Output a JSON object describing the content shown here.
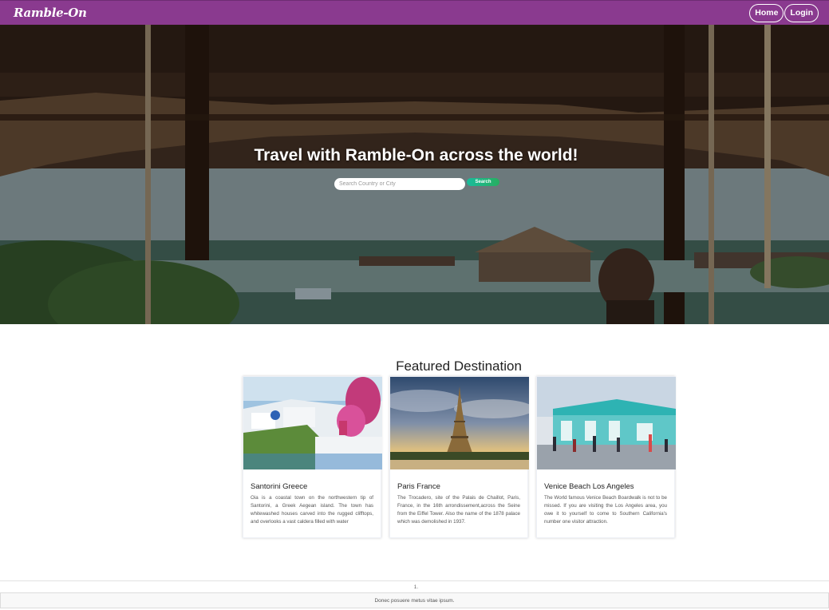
{
  "navbar": {
    "brand": "Ramble-On",
    "home_label": "Home",
    "login_label": "Login",
    "background": "#8a3a8f"
  },
  "hero": {
    "title": "Travel with Ramble-On across the world!",
    "search_placeholder": "Search Country or City",
    "search_value": "",
    "search_button_label": "Search"
  },
  "featured": {
    "title": "Featured Destination",
    "cards": [
      {
        "title": "Santorini Greece",
        "text": "Oia is a coastal town on the northwestern tip of Santorini, a Greek Aegean island. The town has whitewashed houses carved into the rugged clifftops, and overlooks a vast caldera filled with water"
      },
      {
        "title": "Paris France",
        "text": "The Trocadero, site of the Palais de Chaillot, Paris, France, in the 16th arrondissement,across the Seine from the Eiffel Tower. Also the name of the 1878 palace which was demolished in 1937."
      },
      {
        "title": "Venice Beach Los Angeles",
        "text": "The World famous Venice Beach Boardwalk is not to be missed. If you are visiting the Los Angeles area, you owe it to yourself to come to Southern California's number one visitor attraction."
      }
    ]
  },
  "footer": {
    "number": "1.",
    "text": "Donec posuere metus vitae ipsum."
  }
}
